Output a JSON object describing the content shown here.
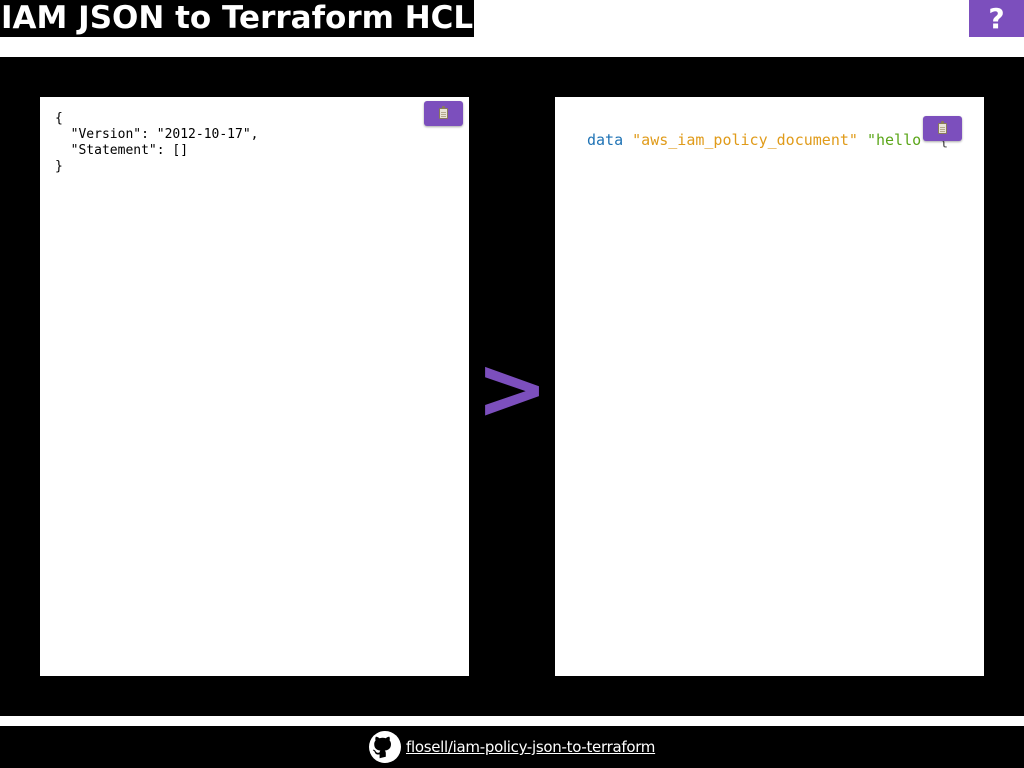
{
  "header": {
    "title": "IAM JSON to Terraform HCL",
    "help_label": "?"
  },
  "editor": {
    "json_input": "{\n  \"Version\": \"2012-10-17\",\n  \"Statement\": []\n}",
    "copy_icon": "clipboard-icon"
  },
  "arrow": {
    "symbol": ">"
  },
  "output": {
    "keyword": "data",
    "resource_type": "\"aws_iam_policy_document\"",
    "resource_name": "\"hello\"",
    "open_brace": "{",
    "copy_icon": "clipboard-icon"
  },
  "footer": {
    "repo_link": "flosell/iam-policy-json-to-terraform",
    "icon": "github-icon"
  },
  "colors": {
    "accent": "#7c4fbd",
    "keyword": "#1f73b5",
    "string_type": "#e09b1a",
    "string_name": "#5ba619"
  }
}
